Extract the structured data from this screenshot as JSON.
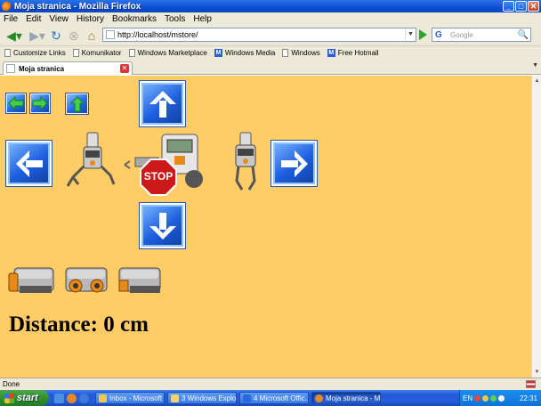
{
  "window": {
    "title": "Moja stranica - Mozilla Firefox",
    "controls": [
      "_",
      "□",
      "✕"
    ]
  },
  "menu": [
    "File",
    "Edit",
    "View",
    "History",
    "Bookmarks",
    "Tools",
    "Help"
  ],
  "nav": {
    "url": "http://localhost/mstore/",
    "search_placeholder": "Google",
    "search_icon_letter": "G"
  },
  "bookmarks": [
    {
      "label": "Customize Links",
      "icon": "page"
    },
    {
      "label": "Komunikator",
      "icon": "page"
    },
    {
      "label": "Windows Marketplace",
      "icon": "page"
    },
    {
      "label": "Windows Media",
      "icon": "ms"
    },
    {
      "label": "Windows",
      "icon": "page"
    },
    {
      "label": "Free Hotmail",
      "icon": "ms"
    }
  ],
  "tab": {
    "title": "Moja stranica",
    "close": "✕"
  },
  "content": {
    "stop_label": "STOP",
    "distance_text": "Distance: 0 cm",
    "colors": {
      "background": "#ffcc66",
      "button_blue": "#1c5ee0",
      "stop_red": "#cc1a1a"
    }
  },
  "status": {
    "text": "Done"
  },
  "taskbar": {
    "start_label": "start",
    "tasks": [
      {
        "label": "Inbox - Microsoft ...",
        "active": false
      },
      {
        "label": "3 Windows Explo...",
        "active": false
      },
      {
        "label": "4 Microsoft Offic...",
        "active": false
      },
      {
        "label": "Moja stranica - Mo...",
        "active": true
      }
    ],
    "tray": {
      "language": "EN",
      "clock": "22:31"
    }
  }
}
